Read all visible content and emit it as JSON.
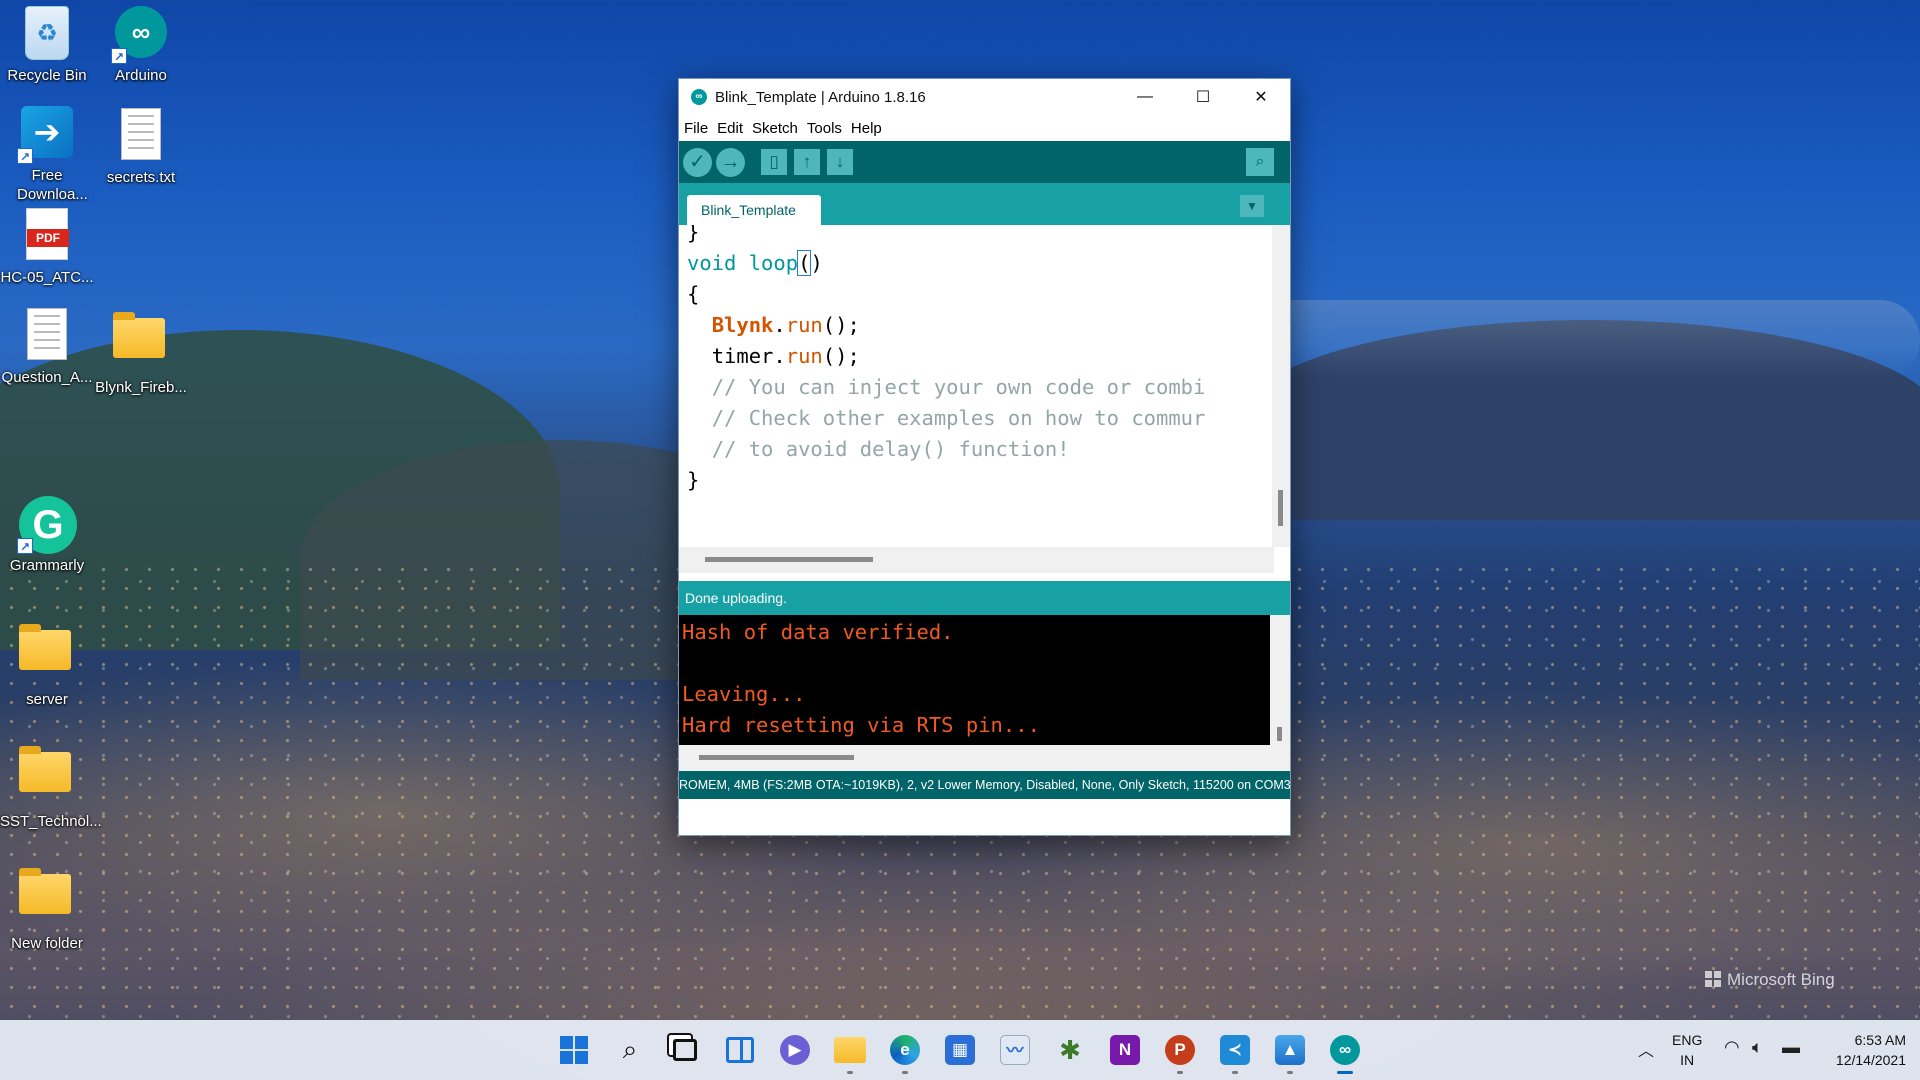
{
  "desktop": {
    "icons": [
      {
        "label": "Recycle Bin",
        "icon": "recycle-bin-icon"
      },
      {
        "label": "Arduino",
        "icon": "arduino-icon"
      },
      {
        "label": "Free Downloa...",
        "icon": "free-download-icon"
      },
      {
        "label": "secrets.txt",
        "icon": "text-file-icon"
      },
      {
        "label": "HC-05_ATC...",
        "icon": "pdf-file-icon"
      },
      {
        "label": "Question_A...",
        "icon": "text-file-icon"
      },
      {
        "label": "Blynk_Fireb...",
        "icon": "folder-icon"
      },
      {
        "label": "Grammarly",
        "icon": "grammarly-icon"
      },
      {
        "label": "server",
        "icon": "folder-icon"
      },
      {
        "label": "SST_Technol...",
        "icon": "folder-icon"
      },
      {
        "label": "New folder",
        "icon": "folder-icon"
      }
    ],
    "pdf_tag": "PDF",
    "watermark": "Microsoft Bing"
  },
  "window": {
    "title": "Blink_Template | Arduino 1.8.16",
    "menu": [
      "File",
      "Edit",
      "Sketch",
      "Tools",
      "Help"
    ],
    "tab_label": "Blink_Template",
    "status_text": "Done uploading.",
    "board_info": "ROMEM, 4MB (FS:2MB OTA:~1019KB), 2, v2 Lower Memory, Disabled, None, Only Sketch, 115200 on COM3",
    "code": {
      "line0": "}",
      "line1_kw": "void",
      "line1_fn": "loop",
      "line1_open": "(",
      "line1_close": ")",
      "line2": "{",
      "line3_obj": "Blynk",
      "line3_dot": ".",
      "line3_fn": "run",
      "line3_end": "();",
      "line4_obj": "timer",
      "line4_dot": ".",
      "line4_fn": "run",
      "line4_end": "();",
      "line5": "// You can inject your own code or combi",
      "line6": "// Check other examples on how to commur",
      "line7": "// to avoid delay() function!",
      "line8": "}"
    },
    "console": {
      "line1": "Hash of data verified.",
      "line2": "",
      "line3": "Leaving...",
      "line4": "Hard resetting via RTS pin..."
    }
  },
  "taskbar": {
    "apps": [
      {
        "name": "start",
        "icon": "windows-start-icon"
      },
      {
        "name": "search",
        "icon": "search-icon"
      },
      {
        "name": "task view",
        "icon": "task-view-icon"
      },
      {
        "name": "widgets",
        "icon": "widgets-icon"
      },
      {
        "name": "teams chat",
        "icon": "chat-icon"
      },
      {
        "name": "file explorer",
        "icon": "file-explorer-icon"
      },
      {
        "name": "edge",
        "icon": "edge-icon"
      },
      {
        "name": "store",
        "icon": "store-icon"
      },
      {
        "name": "performance monitor",
        "icon": "monitor-icon"
      },
      {
        "name": "palm tree app",
        "icon": "palm-tree-icon"
      },
      {
        "name": "onenote",
        "icon": "onenote-icon"
      },
      {
        "name": "powerpoint",
        "icon": "powerpoint-icon"
      },
      {
        "name": "vs code",
        "icon": "vscode-icon"
      },
      {
        "name": "photos",
        "icon": "photos-icon"
      },
      {
        "name": "arduino",
        "icon": "arduino-icon"
      }
    ],
    "lang_top": "ENG",
    "lang_bottom": "IN",
    "time": "6:53 AM",
    "date": "12/14/2021"
  }
}
